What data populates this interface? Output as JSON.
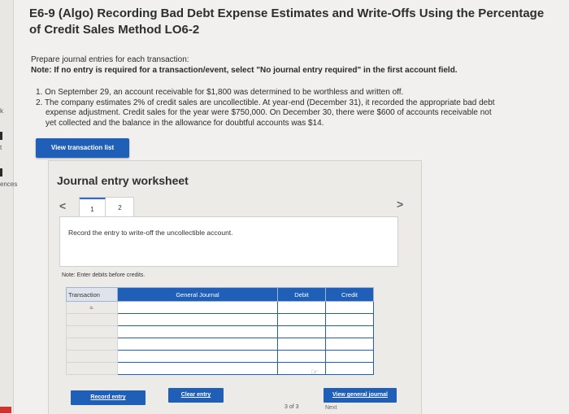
{
  "title": "E6-9 (Algo) Recording Bad Debt Expense Estimates and Write-Offs Using the Percentage of Credit Sales Method LO6-2",
  "side_labels": {
    "k": "k",
    "t": "t",
    "ences": "ences"
  },
  "instructions": {
    "line1": "Prepare journal entries for each transaction:",
    "note": "Note: If no entry is required for a transaction/event, select \"No journal entry required\" in the first account field."
  },
  "items": [
    "1. On September 29, an account receivable for $1,800 was determined to be worthless and written off.",
    "2. The company estimates 2% of credit sales are uncollectible. At year-end (December 31), it recorded the appropriate bad debt",
    "expense adjustment. Credit sales for the year were $750,000. On December 30, there were $600 of accounts receivable not",
    "yet collected and the balance in the allowance for doubtful accounts was $14."
  ],
  "view_transaction_list": "View transaction list",
  "worksheet": {
    "title": "Journal entry worksheet",
    "prev": "<",
    "next": ">",
    "tabs": [
      "1",
      "2"
    ],
    "description": "Record the entry to write-off the uncollectible account.",
    "note": "Note: Enter debits before credits.",
    "columns": {
      "transaction": "Transaction",
      "general_journal": "General Journal",
      "debit": "Debit",
      "credit": "Credit"
    },
    "first_row_transaction": "a.",
    "record_entry": "Record entry",
    "clear_entry": "Clear entry",
    "view_general_journal": "View general journal"
  },
  "footer": {
    "pager": "3 of 3",
    "next": "Next"
  },
  "colors": {
    "accent": "#1f5fb8",
    "background": "#f1f0ee"
  }
}
